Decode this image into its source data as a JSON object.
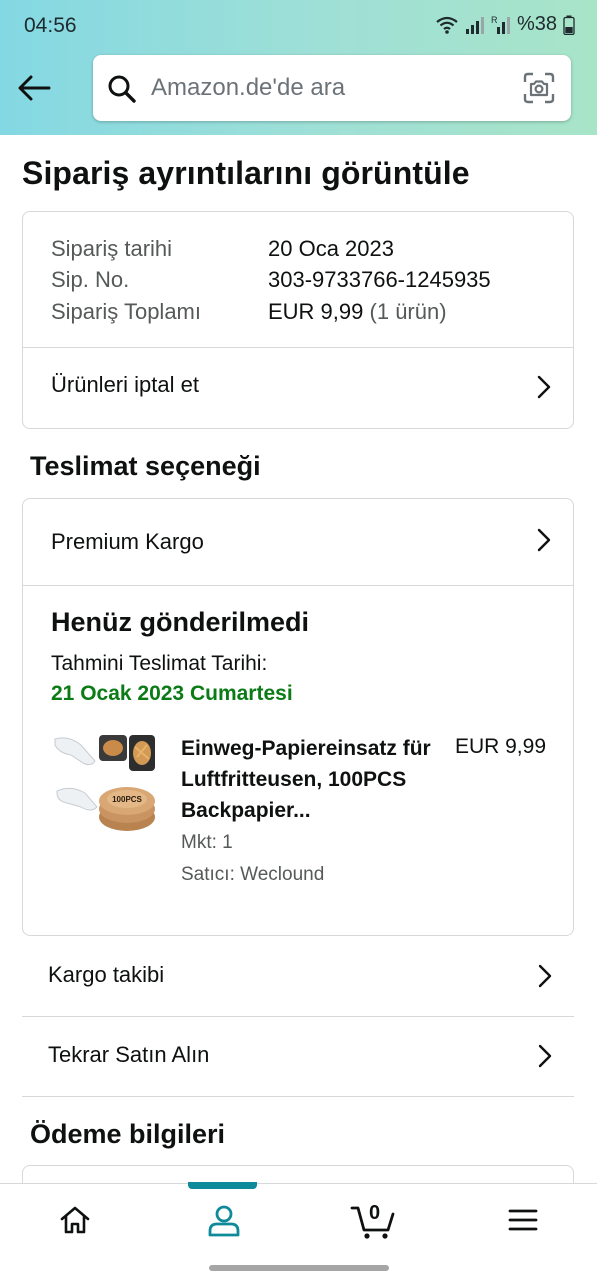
{
  "status_bar": {
    "time": "04:56",
    "battery": "%38"
  },
  "search": {
    "placeholder": "Amazon.de'de ara"
  },
  "page_title": "Sipariş ayrıntılarını görüntüle",
  "order_info": {
    "rows": [
      {
        "label": "Sipariş tarihi",
        "value": "20 Oca 2023",
        "extra": ""
      },
      {
        "label": "Sip. No.",
        "value": "303-9733766-1245935",
        "extra": ""
      },
      {
        "label": "Sipariş Toplamı",
        "value": "EUR 9,99",
        "extra": "(1 ürün)"
      }
    ],
    "cancel_label": "Ürünleri iptal et"
  },
  "delivery": {
    "section_title": "Teslimat seçeneği",
    "option_label": "Premium Kargo",
    "shipment_status": "Henüz gönderilmedi",
    "estimate_label": "Tahmini Teslimat Tarihi:",
    "estimate_date": "21 Ocak 2023 Cumartesi",
    "estimate_color": "#0b7b16",
    "product": {
      "name": "Einweg-Papiereinsatz für Luftfritteusen, 100PCS Backpapier...",
      "price": "EUR 9,99",
      "quantity": "Mkt: 1",
      "seller": "Satıcı: Weclound",
      "image_badge": "100PCS"
    }
  },
  "actions": {
    "track_label": "Kargo takibi",
    "buy_again_label": "Tekrar Satın Alın"
  },
  "payment": {
    "section_title": "Ödeme bilgileri"
  },
  "bottom_nav": {
    "items": [
      {
        "icon": "home-icon"
      },
      {
        "icon": "account-icon",
        "active": true
      },
      {
        "icon": "cart-icon",
        "count": "0"
      },
      {
        "icon": "menu-icon"
      }
    ],
    "active_color": "#0e8a9a"
  }
}
